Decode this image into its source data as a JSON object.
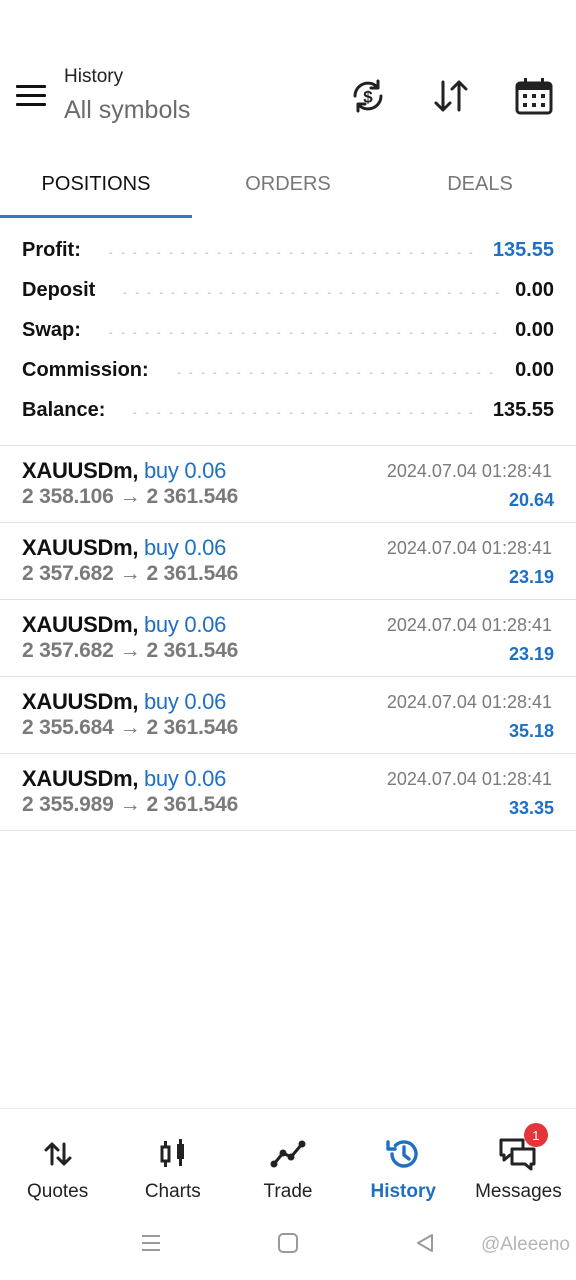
{
  "header": {
    "title": "History",
    "subtitle": "All symbols",
    "icons": [
      "menu-icon",
      "currency-sync-icon",
      "sort-icon",
      "calendar-icon"
    ]
  },
  "tabs": [
    {
      "label": "POSITIONS",
      "active": true
    },
    {
      "label": "ORDERS",
      "active": false
    },
    {
      "label": "DEALS",
      "active": false
    }
  ],
  "summary": {
    "profit_label": "Profit:",
    "profit_value": "135.55",
    "deposit_label": "Deposit",
    "deposit_value": "0.00",
    "swap_label": "Swap:",
    "swap_value": "0.00",
    "commission_label": "Commission:",
    "commission_value": "0.00",
    "balance_label": "Balance:",
    "balance_value": "135.55"
  },
  "positions": [
    {
      "symbol": "XAUUSDm,",
      "side": "buy 0.06",
      "open_price": "2 358.106",
      "close_price": "2 361.546",
      "time": "2024.07.04 01:28:41",
      "profit": "20.64"
    },
    {
      "symbol": "XAUUSDm,",
      "side": "buy 0.06",
      "open_price": "2 357.682",
      "close_price": "2 361.546",
      "time": "2024.07.04 01:28:41",
      "profit": "23.19"
    },
    {
      "symbol": "XAUUSDm,",
      "side": "buy 0.06",
      "open_price": "2 357.682",
      "close_price": "2 361.546",
      "time": "2024.07.04 01:28:41",
      "profit": "23.19"
    },
    {
      "symbol": "XAUUSDm,",
      "side": "buy 0.06",
      "open_price": "2 355.684",
      "close_price": "2 361.546",
      "time": "2024.07.04 01:28:41",
      "profit": "35.18"
    },
    {
      "symbol": "XAUUSDm,",
      "side": "buy 0.06",
      "open_price": "2 355.989",
      "close_price": "2 361.546",
      "time": "2024.07.04 01:28:41",
      "profit": "33.35"
    }
  ],
  "arrow_glyph": "→",
  "bottom_nav": [
    {
      "label": "Quotes",
      "icon": "quotes-icon",
      "active": false
    },
    {
      "label": "Charts",
      "icon": "candlestick-icon",
      "active": false
    },
    {
      "label": "Trade",
      "icon": "trade-icon",
      "active": false
    },
    {
      "label": "History",
      "icon": "history-icon",
      "active": true
    },
    {
      "label": "Messages",
      "icon": "messages-icon",
      "active": false,
      "badge": "1"
    }
  ],
  "system_bar": {
    "watermark": "@Aleeeno"
  },
  "colors": {
    "accent": "#1f6fc5",
    "tab_indicator": "#2f7ad1",
    "badge": "#e2363a",
    "muted": "#7a7a7a"
  }
}
